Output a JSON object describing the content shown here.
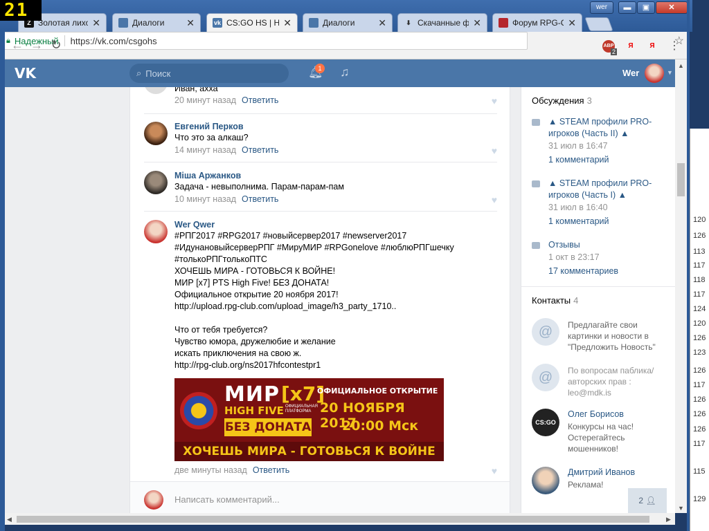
{
  "fps_counter": "21",
  "window": {
    "profile": "wer",
    "minimize": "▬",
    "maximize": "▣",
    "close": "✕"
  },
  "tabs": [
    {
      "label": "Золотая лихорадка",
      "icon": "Z"
    },
    {
      "label": "Диалоги",
      "icon": ""
    },
    {
      "label": "CS:GO HS | Home",
      "icon": "vk"
    },
    {
      "label": "Диалоги",
      "icon": ""
    },
    {
      "label": "Скачанные файлы",
      "icon": "⬇"
    },
    {
      "label": "Форум RPG-Club",
      "icon": ""
    }
  ],
  "address_bar": {
    "secure_label": "Надежный",
    "url": "https://vk.com/csgohs"
  },
  "extensions": {
    "abp": "ABP",
    "abp_count": "2",
    "y1": "Я",
    "y2": "Я"
  },
  "vk": {
    "search_placeholder": "Поиск",
    "notification_count": "1",
    "user_name": "Wer"
  },
  "comments": [
    {
      "author": "",
      "text": "Иван, ахха",
      "time": "20 минут назад",
      "reply": "Ответить"
    },
    {
      "author": "Евгений Перков",
      "text": "Что это за алкаш?",
      "time": "14 минут назад",
      "reply": "Ответить"
    },
    {
      "author": "Міша Аржанков",
      "text": "Задача - невыполнима. Парам-парам-пам",
      "time": "10 минут назад",
      "reply": "Ответить"
    },
    {
      "author": "Wer Qwer",
      "time": "две минуты назад",
      "reply": "Ответить",
      "hashtags": "#РПГ2017 #RPG2017 #новыйсервер2017 #newserver2017 #ИдунановыйсерверРПГ #МируМИР #RPGonelove #люблюРПГшечку #толькоРПГтолькоПТС",
      "line1": "ХОЧЕШЬ МИРА - ГОТОВЬСЯ К ВОЙНЕ!",
      "line2": "МИР [x7] PTS High Five! БЕЗ ДОНАТА!",
      "line3": "Официальное открытие 20 ноября 2017!",
      "link1": "http://upload.rpg-club.com/upload_image/h3_party_1710..",
      "line4": "Что от тебя требуется?",
      "line5": "Чувство юмора, дружелюбие и желание",
      "line6": "искать приключения на свою ж.",
      "link2": "http://rpg-club.org/ns2017hfcontestpr1"
    }
  ],
  "banner": {
    "title": "МИР",
    "x7": "[x7]",
    "high_five": "HIGH FIVE",
    "platform": "ОФИЦИАЛЬНАЯ ПЛАТФОРМА",
    "no_donate": "БЕЗ ДОНАТА",
    "official_opening": "ОФИЦИАЛЬНОЕ ОТКРЫТИЕ",
    "date": "20 НОЯБРЯ 2017",
    "time": "20:00 Мск",
    "slogan": "ХОЧЕШЬ МИРА - ГОТОВЬСЯ К ВОЙНЕ"
  },
  "compose_placeholder": "Написать комментарий...",
  "discussions": {
    "title": "Обсуждения",
    "count": "3",
    "items": [
      {
        "title": "▲ STEAM профили PRO-игроков (Часть II) ▲",
        "date": "31 июл в 16:47",
        "comments": "1 комментарий"
      },
      {
        "title": "▲ STEAM профили PRO-игроков (Часть I) ▲",
        "date": "31 июл в 16:40",
        "comments": "1 комментарий"
      },
      {
        "title": "Отзывы",
        "date": "1 окт в 23:17",
        "comments": "17 комментариев"
      }
    ]
  },
  "contacts": {
    "title": "Контакты",
    "count": "4",
    "items": [
      {
        "name": "",
        "desc": "Предлагайте свои картинки и новости в \"Предложить Новость\""
      },
      {
        "name": "",
        "desc": "По вопросам паблика/авторских прав : leo@mdk.is"
      },
      {
        "name": "Олег Борисов",
        "desc": "Конкурсы на час! Остерегайтесь мошенников!"
      },
      {
        "name": "Дмитрий Иванов",
        "desc": "Реклама!"
      }
    ]
  },
  "members_count": "2",
  "right_numbers": [
    "120",
    "126",
    "113",
    "117",
    "118",
    "117",
    "124",
    "120",
    "126",
    "123",
    "126",
    "117",
    "126",
    "126",
    "126",
    "117",
    "115",
    "129"
  ]
}
